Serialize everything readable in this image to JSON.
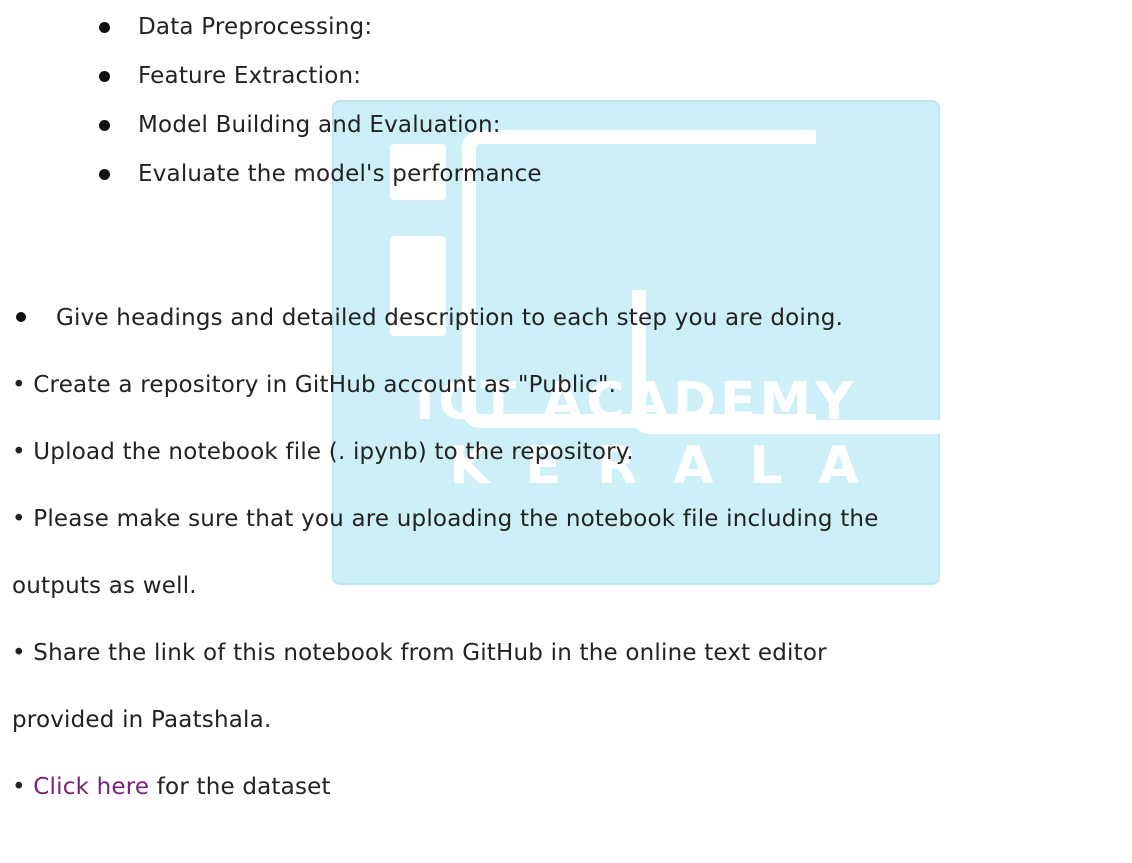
{
  "watermark": {
    "line1": "ICT ACADEMY",
    "line2": "KERALA"
  },
  "steps": [
    "Data Preprocessing:",
    "Feature Extraction:",
    "Model Building and Evaluation:",
    "Evaluate the model's performance"
  ],
  "instructions": {
    "headings": "Give headings and detailed description to each step you are doing.",
    "repo": "• Create a repository in GitHub account as \"Public\".",
    "upload": "• Upload the notebook file (. ipynb) to the repository.",
    "outputs_line1": "• Please make sure that you are uploading the notebook file including the",
    "outputs_line2": "outputs as well.",
    "share_line1": "• Share the link of this notebook from GitHub in the online text editor",
    "share_line2": "provided in Paatshala.",
    "dataset_prefix": "• ",
    "dataset_link": "Click here",
    "dataset_suffix": " for the dataset"
  },
  "colors": {
    "link": "#7a1f7a",
    "watermark_bg": "#cdeff8"
  }
}
